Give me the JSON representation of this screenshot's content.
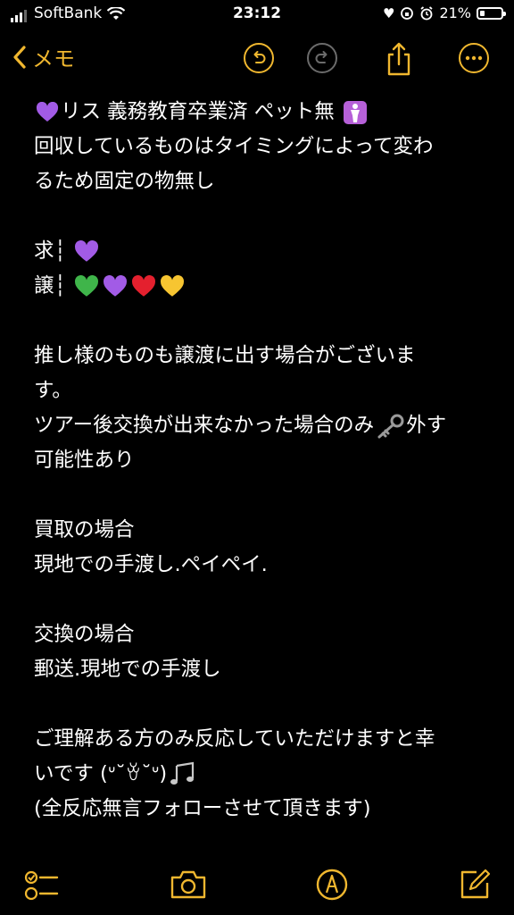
{
  "status_bar": {
    "carrier": "SoftBank",
    "time": "23:12",
    "battery": "21%",
    "battery_level": 0.21
  },
  "nav": {
    "back_label": "メモ"
  },
  "note": {
    "lines": [
      {
        "text": "リス 義務教育卒業済 ペット無 ",
        "emoji_before": "purple-heart",
        "emoji_after": "person-icon"
      },
      {
        "text": "回収しているものはタイミングによって変わ"
      },
      {
        "text": "るため固定の物無し"
      },
      {
        "text": ""
      },
      {
        "text": "求┆ ",
        "emojis": [
          "purple-heart"
        ]
      },
      {
        "text": "譲┆ ",
        "emojis": [
          "green-heart",
          "purple-heart",
          "red-heart",
          "yellow-heart"
        ]
      },
      {
        "text": ""
      },
      {
        "text": "推し様のものも譲渡に出す場合がございま"
      },
      {
        "text": "す。"
      },
      {
        "text": "ツアー後交換が出来なかった場合のみ",
        "emoji_after": "key",
        "text_after": "外す"
      },
      {
        "text": "可能性あり"
      },
      {
        "text": ""
      },
      {
        "text": "買取の場合"
      },
      {
        "text": "現地での手渡し.ペイペイ."
      },
      {
        "text": ""
      },
      {
        "text": "交換の場合"
      },
      {
        "text": "郵送.現地での手渡し"
      },
      {
        "text": ""
      },
      {
        "text": "ご理解ある方のみ反応していただけますと幸"
      },
      {
        "text": "いです (ᐡ˘ꈊ˘ᐡ)",
        "emoji_after": "musical-notes"
      },
      {
        "text": "(全反応無言フォローさせて頂きます)"
      }
    ]
  },
  "colors": {
    "accent": "#f0b72f",
    "background": "#000000",
    "text": "#ffffff",
    "disabled": "#6b6b6b"
  },
  "icons": {
    "undo": "undo-icon",
    "redo": "redo-icon",
    "share": "share-icon",
    "more": "more-icon",
    "checklist": "checklist-icon",
    "camera": "camera-icon",
    "markup": "markup-icon",
    "compose": "compose-icon"
  }
}
